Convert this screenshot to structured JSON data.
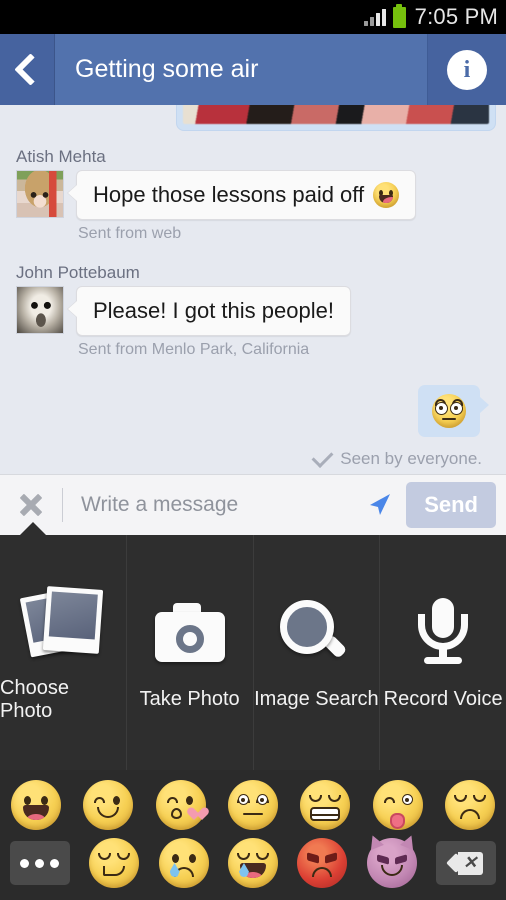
{
  "statusbar": {
    "time": "7:05 PM",
    "battery_icon": "battery-full-icon",
    "signal_icon": "signal-bars-icon"
  },
  "header": {
    "title": "Getting some air",
    "back_icon": "back-chevron-icon",
    "info_icon": "info-icon",
    "bg_color": "#5272ad"
  },
  "thread": {
    "photo_attachment": "photo-attachment-thumbnail",
    "messages": [
      {
        "sender": "Atish Mehta",
        "text": "Hope those lessons paid off",
        "emoji": "grinning-face",
        "meta": "Sent from web",
        "avatar": "avatar-atish-mehta"
      },
      {
        "sender": "John Pottebaum",
        "text": "Please! I got this people!",
        "emoji": "",
        "meta": "Sent from Menlo Park, California",
        "avatar": "avatar-john-pottebaum"
      }
    ],
    "sent_message": {
      "emoji": "flushed-face",
      "bubble_color": "#cfe0f4"
    },
    "seen_status": "Seen by everyone.",
    "seen_icon": "checkmark-icon"
  },
  "composer": {
    "close_icon": "close-x-icon",
    "placeholder": "Write a message",
    "value": "",
    "location_icon": "location-arrow-icon",
    "send_label": "Send",
    "send_enabled": false,
    "send_color": "#c3cbe0"
  },
  "attach_panel": {
    "items": [
      {
        "label": "Choose Photo",
        "icon": "photos-stack-icon"
      },
      {
        "label": "Take Photo",
        "icon": "camera-icon"
      },
      {
        "label": "Image Search",
        "icon": "magnifier-icon"
      },
      {
        "label": "Record Voice",
        "icon": "microphone-icon"
      }
    ]
  },
  "emoji_keyboard": {
    "row1": [
      {
        "name": "grinning-face"
      },
      {
        "name": "winking-face"
      },
      {
        "name": "face-blowing-a-kiss"
      },
      {
        "name": "flushed-face"
      },
      {
        "name": "grimacing-face"
      },
      {
        "name": "winking-face-with-tongue"
      },
      {
        "name": "unamused-face"
      }
    ],
    "row2": [
      {
        "name": "more-emoji-button",
        "type": "key"
      },
      {
        "name": "smirking-face"
      },
      {
        "name": "crying-face"
      },
      {
        "name": "face-with-tears-of-joy"
      },
      {
        "name": "pouting-face"
      },
      {
        "name": "smiling-face-with-horns"
      },
      {
        "name": "backspace-key",
        "type": "key"
      }
    ]
  }
}
